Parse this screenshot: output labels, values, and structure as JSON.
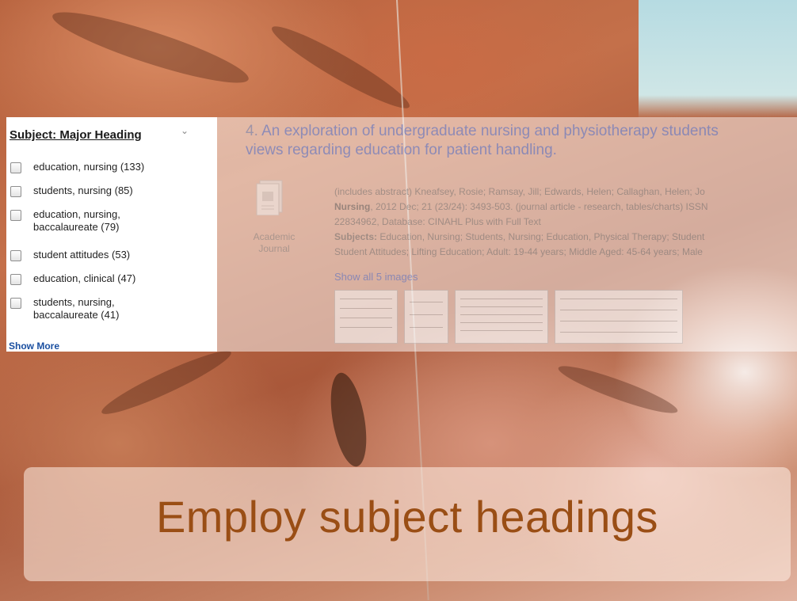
{
  "facet": {
    "title": "Subject: Major Heading",
    "chevron_icon": "chevron-down-icon",
    "items": [
      {
        "label": "education, nursing (133)"
      },
      {
        "label": "students, nursing (85)"
      },
      {
        "label": "education, nursing, baccalaureate (79)"
      },
      {
        "label": "student attitudes (53)"
      },
      {
        "label": "education, clinical (47)"
      },
      {
        "label": "students, nursing, baccalaureate (41)"
      }
    ],
    "show_more": "Show More"
  },
  "result": {
    "number": "4.",
    "title_line1": "An exploration of undergraduate nursing and physiotherapy students",
    "title_line2": "views regarding education for patient handling.",
    "doc_type": "Academic Journal",
    "meta_line1": "(includes abstract) Kneafsey, Rosie; Ramsay, Jill; Edwards, Helen; Callaghan, Helen; Jo",
    "meta_journal": "Nursing",
    "meta_line2_rest": ", 2012 Dec; 21 (23/24): 3493-503. (journal article - research, tables/charts) ISSN",
    "meta_line3": "22834962, Database: CINAHL Plus with Full Text",
    "subjects_label": "Subjects:",
    "subjects_line1": "Education, Nursing; Students, Nursing; Education, Physical Therapy; Student",
    "subjects_line2": "Student Attitudes; Lifting Education; Adult: 19-44 years; Middle Aged: 45-64 years; Male",
    "show_images": "Show all 5 images"
  },
  "banner": {
    "text": "Employ subject headings"
  },
  "colors": {
    "banner_text": "#9a4e15",
    "link": "#1a4fa0",
    "result_title": "#3a5fc8"
  }
}
